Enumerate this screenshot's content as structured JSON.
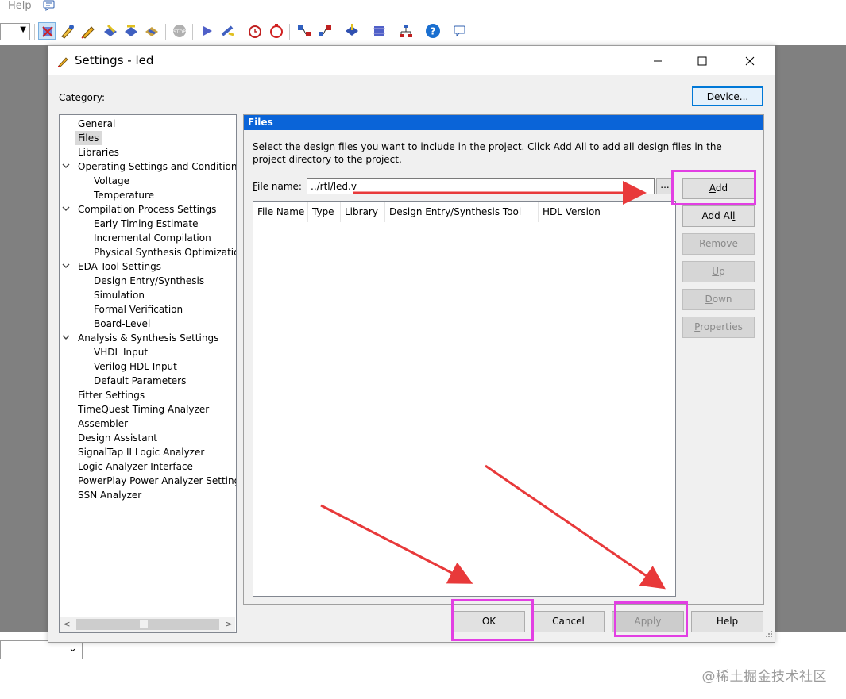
{
  "host": {
    "menu": {
      "help_label": "Help"
    },
    "watermark": "@稀土掘金技术社区"
  },
  "dialog": {
    "title": "Settings - led",
    "category_label": "Category:",
    "device_button": "Device..."
  },
  "tree": {
    "items": [
      {
        "label": "General",
        "level": 0
      },
      {
        "label": "Files",
        "level": 0,
        "selected": true
      },
      {
        "label": "Libraries",
        "level": 0
      },
      {
        "label": "Operating Settings and Conditions",
        "level": 0,
        "expanded": true
      },
      {
        "label": "Voltage",
        "level": 1
      },
      {
        "label": "Temperature",
        "level": 1
      },
      {
        "label": "Compilation Process Settings",
        "level": 0,
        "expanded": true
      },
      {
        "label": "Early Timing Estimate",
        "level": 1
      },
      {
        "label": "Incremental Compilation",
        "level": 1
      },
      {
        "label": "Physical Synthesis Optimization",
        "level": 1
      },
      {
        "label": "EDA Tool Settings",
        "level": 0,
        "expanded": true
      },
      {
        "label": "Design Entry/Synthesis",
        "level": 1
      },
      {
        "label": "Simulation",
        "level": 1
      },
      {
        "label": "Formal Verification",
        "level": 1
      },
      {
        "label": "Board-Level",
        "level": 1
      },
      {
        "label": "Analysis & Synthesis Settings",
        "level": 0,
        "expanded": true
      },
      {
        "label": "VHDL Input",
        "level": 1
      },
      {
        "label": "Verilog HDL Input",
        "level": 1
      },
      {
        "label": "Default Parameters",
        "level": 1
      },
      {
        "label": "Fitter Settings",
        "level": 0
      },
      {
        "label": "TimeQuest Timing Analyzer",
        "level": 0
      },
      {
        "label": "Assembler",
        "level": 0
      },
      {
        "label": "Design Assistant",
        "level": 0
      },
      {
        "label": "SignalTap II Logic Analyzer",
        "level": 0
      },
      {
        "label": "Logic Analyzer Interface",
        "level": 0
      },
      {
        "label": "PowerPlay Power Analyzer Settings",
        "level": 0
      },
      {
        "label": "SSN Analyzer",
        "level": 0
      }
    ]
  },
  "files": {
    "header": "Files",
    "description": "Select the design files you want to include in the project. Click Add All to add all design files in the project directory to the project.",
    "filename_label_accel": "F",
    "filename_label_rest": "ile name:",
    "filename_value": "../rtl/led.v",
    "browse_label": "...",
    "columns": [
      "File Name",
      "Type",
      "Library",
      "Design Entry/Synthesis Tool",
      "HDL Version"
    ],
    "buttons": {
      "add_a": "A",
      "add_b": "dd",
      "addall_a": "Add A",
      "addall_b": "l",
      "addall_c": "l",
      "remove_a": "R",
      "remove_b": "emove",
      "up_a": "U",
      "up_b": "p",
      "down_a": "D",
      "down_b": "own",
      "properties_a": "P",
      "properties_b": "roperties"
    }
  },
  "footer": {
    "ok": "OK",
    "cancel": "Cancel",
    "apply": "Apply",
    "help": "Help"
  },
  "colors": {
    "highlight": "#e23fe3",
    "arrow": "#e8393a",
    "panel_header": "#0a64d8",
    "focus_border": "#0078d7"
  }
}
